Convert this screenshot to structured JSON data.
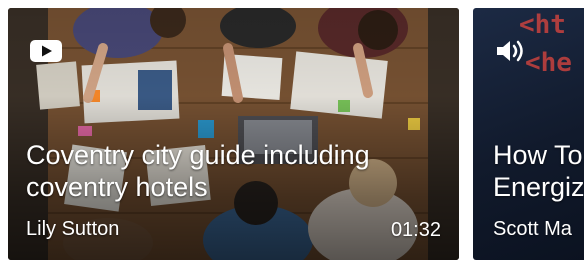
{
  "cards": [
    {
      "media_type": "video",
      "media_icon": "youtube-play-icon",
      "title": "Coventry city guide including coventry hotels",
      "author": "Lily Sutton",
      "duration": "01:32",
      "image": "overhead-table-workshop-photo"
    },
    {
      "media_type": "audio",
      "media_icon": "speaker-volume-icon",
      "title": "How To",
      "title_line2": "Energiz",
      "author": "Scott Ma",
      "code_lines": [
        "<ht",
        "<he"
      ],
      "image": "code-screen-photo"
    }
  ],
  "colors": {
    "text": "#ffffff",
    "card2_code": "#e0463f",
    "card2_bg": "#141f34",
    "table_wood": "#6b4a2e"
  }
}
